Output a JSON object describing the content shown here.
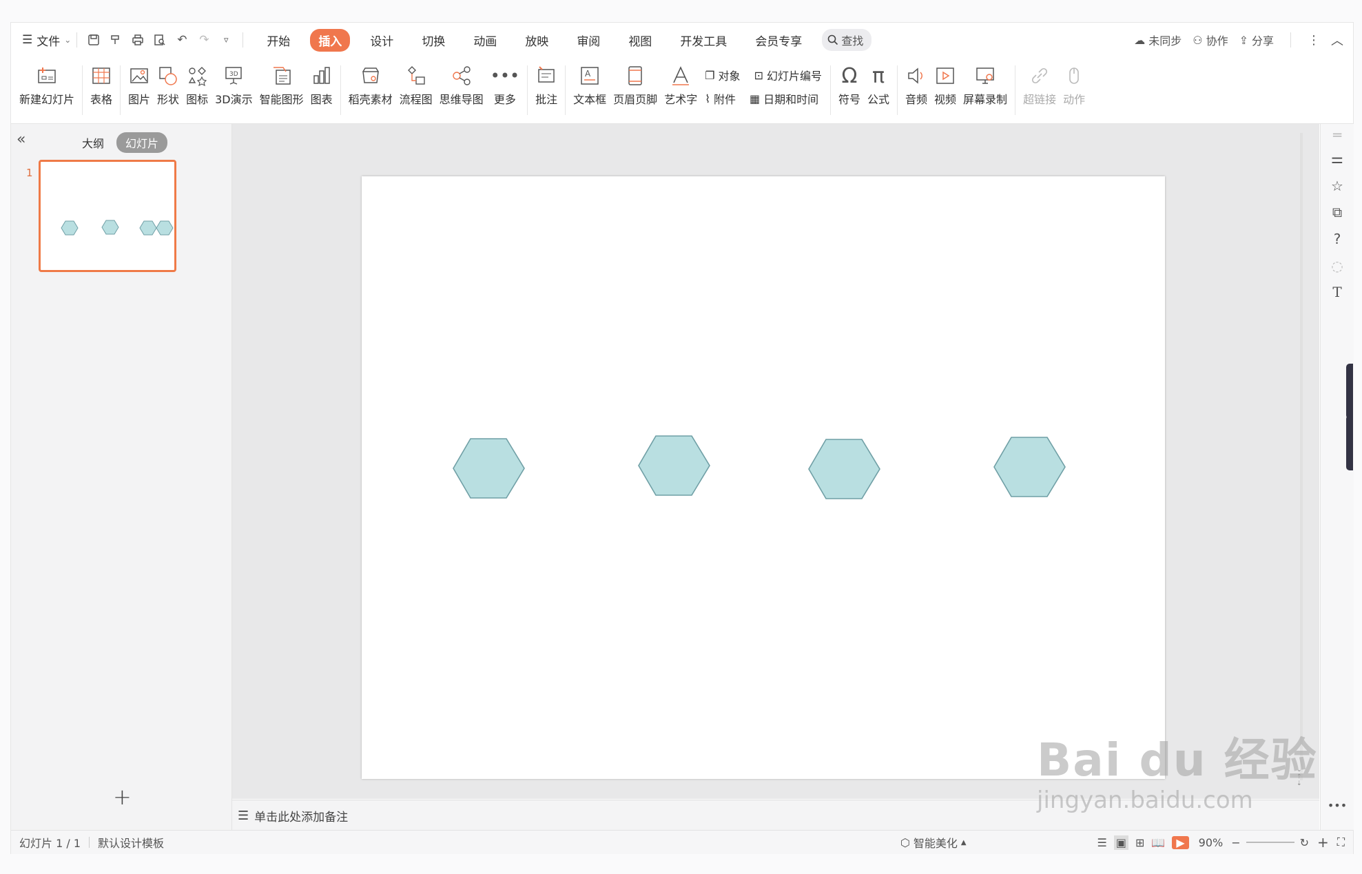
{
  "menu": {
    "file_label": "文件"
  },
  "tabs": [
    {
      "label": "开始",
      "active": false
    },
    {
      "label": "插入",
      "active": true
    },
    {
      "label": "设计",
      "active": false
    },
    {
      "label": "切换",
      "active": false
    },
    {
      "label": "动画",
      "active": false
    },
    {
      "label": "放映",
      "active": false
    },
    {
      "label": "审阅",
      "active": false
    },
    {
      "label": "视图",
      "active": false
    },
    {
      "label": "开发工具",
      "active": false
    },
    {
      "label": "会员专享",
      "active": false
    }
  ],
  "search": {
    "label": "查找"
  },
  "top_right": {
    "sync": "未同步",
    "collab": "协作",
    "share": "分享"
  },
  "ribbon": {
    "new_slide": "新建幻灯片",
    "table": "表格",
    "picture": "图片",
    "shape": "形状",
    "icon": "图标",
    "demo3d": "3D演示",
    "smartart": "智能图形",
    "chart": "图表",
    "material": "稻壳素材",
    "flowchart": "流程图",
    "mindmap": "思维导图",
    "more": "更多",
    "comment": "批注",
    "textbox": "文本框",
    "header_footer": "页眉页脚",
    "wordart": "艺术字",
    "object": "对象",
    "slide_number": "幻灯片编号",
    "attachment": "附件",
    "datetime": "日期和时间",
    "symbol": "符号",
    "formula": "公式",
    "audio": "音频",
    "video": "视频",
    "screen_record": "屏幕录制",
    "hyperlink": "超链接",
    "action": "动作"
  },
  "left_panel": {
    "outline_tab": "大纲",
    "slides_tab": "幻灯片",
    "slide_number": "1"
  },
  "notes": {
    "placeholder": "单击此处添加备注"
  },
  "status": {
    "slide_info": "幻灯片 1 / 1",
    "template": "默认设计模板",
    "beautify": "智能美化",
    "zoom": "90%"
  },
  "slide": {
    "shape_fill": "#b9dfe1",
    "shape_stroke": "#6f9fa5",
    "shape_count": 4
  },
  "colors": {
    "accent": "#f0774d",
    "thumb_border": "#ef7a47"
  },
  "watermark": {
    "brand": "Bai du 经验",
    "url": "jingyan.baidu.com"
  }
}
